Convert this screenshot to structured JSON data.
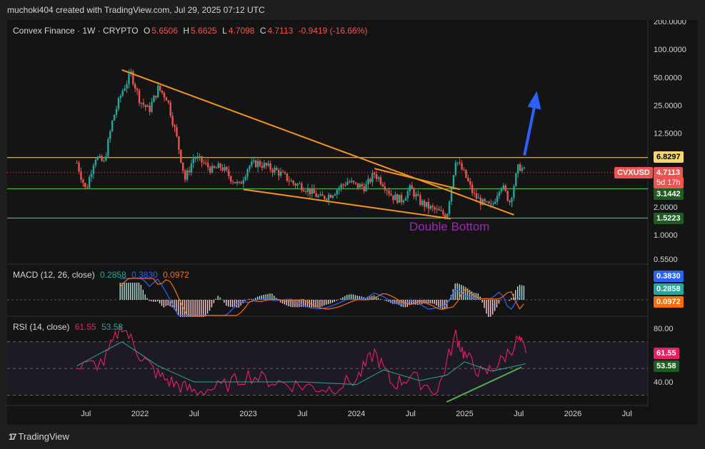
{
  "header": {
    "credit": "muchoki404 created with TradingView.com, Jul 29, 2025 07:12 UTC"
  },
  "price_legend": {
    "symbol": "Convex Finance · 1W · CRYPTO",
    "o_label": "O",
    "o": "5.6506",
    "h_label": "H",
    "h": "5.6625",
    "l_label": "L",
    "l": "4.7098",
    "c_label": "C",
    "c": "4.7113",
    "change": "-0.9419 (-16.66%)"
  },
  "macd_legend": {
    "title": "MACD (12, 26, close)",
    "v1": "0.2858",
    "v2": "0.3830",
    "v3": "0.0972"
  },
  "rsi_legend": {
    "title": "RSI (14, close)",
    "v1": "61.55",
    "v2": "53.58"
  },
  "price_tags": {
    "resistance": "6.8297",
    "ticker": "CVXUSD",
    "last": "4.7113",
    "countdown": "5d 17h",
    "support1": "3.1442",
    "support2": "1.5223"
  },
  "macd_tags": {
    "a": "0.3830",
    "b": "0.2858",
    "c": "0.0972"
  },
  "rsi_tags": {
    "a": "61.55",
    "b": "53.58"
  },
  "annotation": "Double Bottom",
  "footer": {
    "brand": "TradingView",
    "logo": "17"
  },
  "colors": {
    "up": "#26a69a",
    "down": "#ef5350",
    "trendline": "#f7931a",
    "resistance": "#f5d76e",
    "support": "#4caf50",
    "arrow": "#2962ff",
    "annotation": "#9c27b0",
    "rsi": "#e91e63"
  },
  "chart_data": [
    {
      "type": "candlestick",
      "title": "Convex Finance · 1W · CRYPTO",
      "yscale": "log",
      "y_ticks": [
        200,
        100,
        50,
        25,
        12.5,
        2,
        1,
        0.55
      ],
      "y_tick_labels": [
        "200.0000",
        "100.0000",
        "50.0000",
        "25.0000",
        "12.5000",
        "2.0000",
        "1.0000",
        "0.5500"
      ],
      "x_tick_labels": [
        "Jul",
        "2022",
        "Jul",
        "2023",
        "Jul",
        "2024",
        "Jul",
        "2025",
        "Jul",
        "2026",
        "Jul"
      ],
      "x_ticks": [
        "2021-07",
        "2022-01",
        "2022-07",
        "2023-01",
        "2023-07",
        "2024-01",
        "2024-07",
        "2025-01",
        "2025-07",
        "2026-01",
        "2026-07"
      ],
      "close_path": [
        [
          "2021-06-01",
          6.0
        ],
        [
          "2021-07-01",
          3.0
        ],
        [
          "2021-08-01",
          7.0
        ],
        [
          "2021-09-01",
          6.0
        ],
        [
          "2021-10-01",
          18.0
        ],
        [
          "2021-11-01",
          35.0
        ],
        [
          "2021-12-01",
          55.0
        ],
        [
          "2022-01-01",
          28.0
        ],
        [
          "2022-02-01",
          22.0
        ],
        [
          "2022-03-01",
          38.0
        ],
        [
          "2022-04-01",
          30.0
        ],
        [
          "2022-05-01",
          12.0
        ],
        [
          "2022-06-01",
          4.0
        ],
        [
          "2022-07-01",
          7.0
        ],
        [
          "2022-08-01",
          6.0
        ],
        [
          "2022-09-01",
          5.0
        ],
        [
          "2022-10-01",
          5.5
        ],
        [
          "2022-11-01",
          4.2
        ],
        [
          "2022-12-01",
          3.4
        ],
        [
          "2023-01-01",
          5.5
        ],
        [
          "2023-02-01",
          6.0
        ],
        [
          "2023-03-01",
          5.5
        ],
        [
          "2023-04-01",
          5.0
        ],
        [
          "2023-05-01",
          4.3
        ],
        [
          "2023-06-01",
          3.6
        ],
        [
          "2023-07-01",
          3.4
        ],
        [
          "2023-08-01",
          2.9
        ],
        [
          "2023-09-01",
          2.5
        ],
        [
          "2023-10-01",
          2.7
        ],
        [
          "2023-11-01",
          3.2
        ],
        [
          "2023-12-01",
          3.8
        ],
        [
          "2024-01-01",
          3.4
        ],
        [
          "2024-02-01",
          3.3
        ],
        [
          "2024-03-01",
          4.6
        ],
        [
          "2024-04-01",
          3.6
        ],
        [
          "2024-05-01",
          2.6
        ],
        [
          "2024-06-01",
          2.4
        ],
        [
          "2024-07-01",
          3.2
        ],
        [
          "2024-08-01",
          2.3
        ],
        [
          "2024-09-01",
          2.0
        ],
        [
          "2024-10-01",
          1.8
        ],
        [
          "2024-11-01",
          1.6
        ],
        [
          "2024-12-01",
          6.6
        ],
        [
          "2025-01-01",
          4.5
        ],
        [
          "2025-02-01",
          2.7
        ],
        [
          "2025-03-01",
          2.2
        ],
        [
          "2025-04-01",
          2.0
        ],
        [
          "2025-05-01",
          3.6
        ],
        [
          "2025-06-01",
          2.3
        ],
        [
          "2025-07-01",
          5.6
        ],
        [
          "2025-07-25",
          4.71
        ]
      ],
      "horizontal_levels": [
        6.8297,
        4.7113,
        3.1442,
        1.5223
      ],
      "trendlines": [
        {
          "from": [
            "2021-11-01",
            60
          ],
          "to": [
            "2025-06-15",
            1.65
          ]
        },
        {
          "from": [
            "2022-12-15",
            3.1
          ],
          "to": [
            "2024-11-15",
            1.5
          ]
        },
        {
          "from": [
            "2024-03-01",
            5.2
          ],
          "to": [
            "2024-12-15",
            3.1
          ]
        }
      ]
    },
    {
      "type": "histogram",
      "title": "MACD (12, 26, close)",
      "values_legend": [
        "0.2858",
        "0.3830",
        "0.0972"
      ]
    },
    {
      "type": "line",
      "title": "RSI (14, close)",
      "y_ticks": [
        80,
        40
      ],
      "y_tick_labels": [
        "80.00",
        "40.00"
      ],
      "bands": [
        70,
        50,
        30
      ],
      "rsi": [
        [
          "2021-06-01",
          50
        ],
        [
          "2021-09-01",
          55
        ],
        [
          "2021-11-01",
          83
        ],
        [
          "2022-01-01",
          60
        ],
        [
          "2022-03-01",
          45
        ],
        [
          "2022-05-01",
          38
        ],
        [
          "2022-07-01",
          33
        ],
        [
          "2022-10-01",
          36
        ],
        [
          "2023-01-01",
          45
        ],
        [
          "2023-04-01",
          40
        ],
        [
          "2023-07-01",
          37
        ],
        [
          "2023-10-01",
          35
        ],
        [
          "2024-01-01",
          42
        ],
        [
          "2024-03-01",
          62
        ],
        [
          "2024-05-01",
          38
        ],
        [
          "2024-07-01",
          44
        ],
        [
          "2024-10-01",
          33
        ],
        [
          "2024-12-01",
          75
        ],
        [
          "2025-01-01",
          60
        ],
        [
          "2025-03-01",
          45
        ],
        [
          "2025-05-01",
          55
        ],
        [
          "2025-07-01",
          72
        ],
        [
          "2025-07-25",
          61.55
        ]
      ],
      "rsi_ma": [
        [
          "2021-06-01",
          52
        ],
        [
          "2021-11-01",
          70
        ],
        [
          "2022-03-01",
          52
        ],
        [
          "2022-07-01",
          40
        ],
        [
          "2023-01-01",
          40
        ],
        [
          "2023-07-01",
          40
        ],
        [
          "2024-01-01",
          38
        ],
        [
          "2024-04-01",
          49
        ],
        [
          "2024-08-01",
          41
        ],
        [
          "2024-11-01",
          45
        ],
        [
          "2025-01-01",
          55
        ],
        [
          "2025-04-01",
          48
        ],
        [
          "2025-07-25",
          53.58
        ]
      ]
    }
  ]
}
